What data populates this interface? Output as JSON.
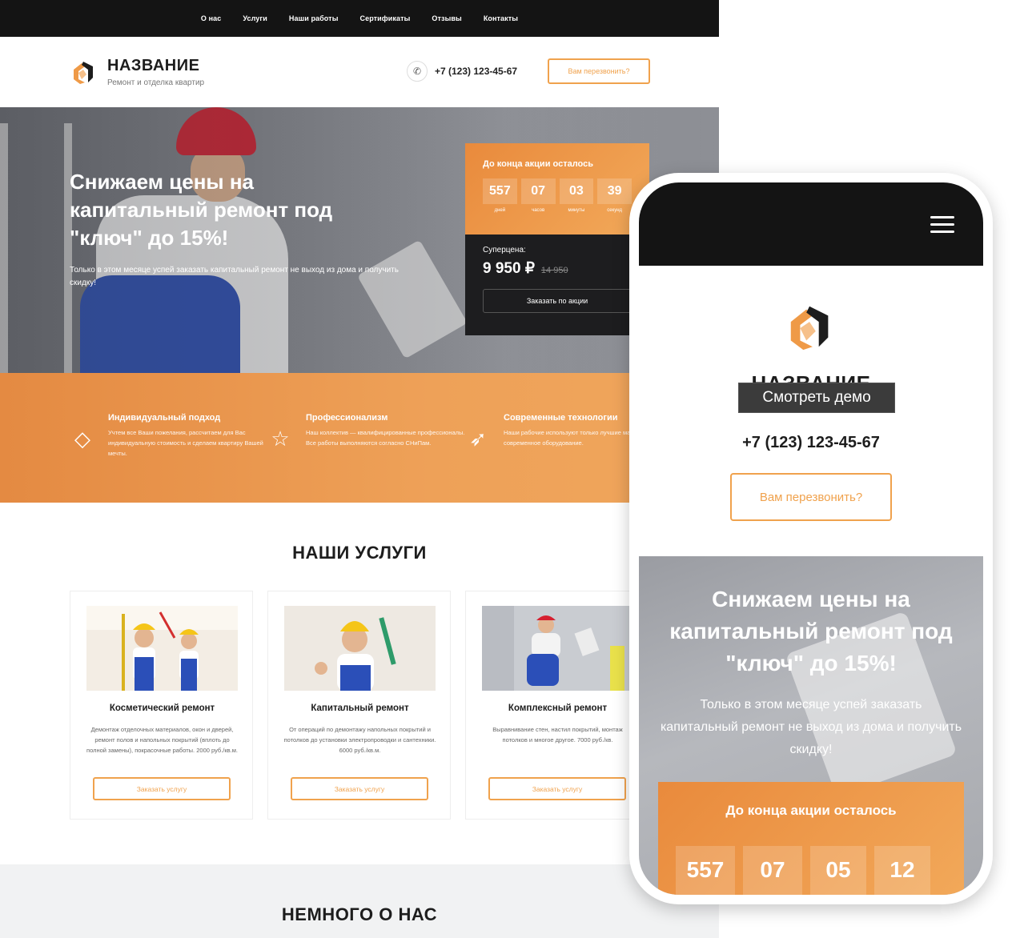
{
  "nav": {
    "items": [
      "О нас",
      "Услуги",
      "Наши работы",
      "Сертификаты",
      "Отзывы",
      "Контакты"
    ]
  },
  "brand": {
    "name": "НАЗВАНИЕ",
    "tagline": "Ремонт и отделка квартир",
    "accent_color": "#f0a24d",
    "dark_color": "#141414"
  },
  "header": {
    "phone": "+7 (123) 123-45-67",
    "callback_label": "Вам перезвонить?"
  },
  "hero": {
    "title": "Снижаем цены на капитальный ремонт под \"ключ\" до 15%!",
    "subtitle": "Только в этом месяце успей заказать капитальный ремонт не выход из дома и получить скидку!"
  },
  "promo": {
    "label": "До конца акции осталось",
    "timer": [
      {
        "value": "557",
        "unit": "дней"
      },
      {
        "value": "07",
        "unit": "часов"
      },
      {
        "value": "03",
        "unit": "минуты"
      },
      {
        "value": "39",
        "unit": "секунд"
      }
    ],
    "super_label": "Суперцена:",
    "price_new": "9 950 ₽",
    "price_old": "14 950",
    "order_label": "Заказать по акции"
  },
  "features": [
    {
      "icon": "diamond-icon",
      "title": "Индивидуальный подход",
      "text": "Учтем все Ваши пожелания, рассчитаем для Вас индивидуальную стоимость и сделаем квартиру Вашей мечты."
    },
    {
      "icon": "star-icon",
      "title": "Профессионализм",
      "text": "Наш коллектив — квалифицированные профессионалы. Все работы выполняются согласно СНиПам."
    },
    {
      "icon": "rocket-icon",
      "title": "Современные технологии",
      "text": "Наши рабочие используют только лучшие материалы и современное оборудование."
    }
  ],
  "services": {
    "title": "НАШИ УСЛУГИ",
    "cards": [
      {
        "title": "Косметический ремонт",
        "text": "Демонтаж отделочных материалов, окон и дверей, ремонт полов и напольных покрытий (вплоть до полной замены), покрасочные работы. 2000 руб./кв.м.",
        "button": "Заказать услугу"
      },
      {
        "title": "Капитальный ремонт",
        "text": "От операций по демонтажу напольных покрытий и потолков до установки электропроводки и сантехники. 6000 руб./кв.м.",
        "button": "Заказать услугу"
      },
      {
        "title": "Комплексный ремонт",
        "text": "Выравнивание стен, настил покрытий, монтаж потолков и многое другое. 7000 руб./кв.",
        "button": "Заказать услугу"
      }
    ]
  },
  "about": {
    "title": "НЕМНОГО О НАС"
  },
  "mobile": {
    "brand_name": "НАЗВАНИЕ",
    "tagline": "Ремонт и отделка квартир",
    "demo_label": "Смотреть демо",
    "phone": "+7 (123) 123-45-67",
    "callback_label": "Вам перезвонить?",
    "hero_title": "Снижаем цены на капитальный ремонт под \"ключ\" до 15%!",
    "hero_subtitle": "Только в этом месяце успей заказать капитальный ремонт не выход из дома и получить скидку!",
    "promo_label": "До конца акции осталось",
    "timer": [
      "557",
      "07",
      "05",
      "12"
    ]
  }
}
